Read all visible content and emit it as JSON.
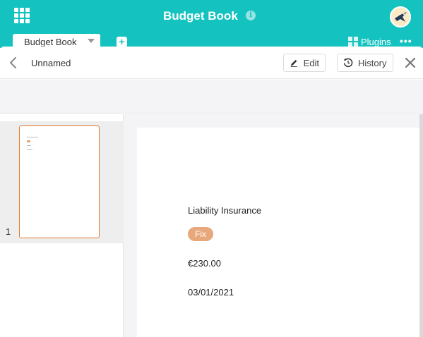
{
  "app": {
    "title": "Budget Book",
    "info_icon": "info-icon",
    "info_glyph": "i",
    "tab_label": "Budget Book",
    "add_glyph": "+",
    "plugins_label": "Plugins",
    "more_glyph": "•••",
    "accent_color": "#14c3c0"
  },
  "record": {
    "title": "Unnamed",
    "edit_label": "Edit",
    "history_label": "History"
  },
  "thumbnails": [
    {
      "page_number": "1"
    }
  ],
  "document": {
    "name": "Liability Insurance",
    "tag": "Fix",
    "tag_color": "#e8a87c",
    "amount": "€230.00",
    "date": "03/01/2021"
  }
}
